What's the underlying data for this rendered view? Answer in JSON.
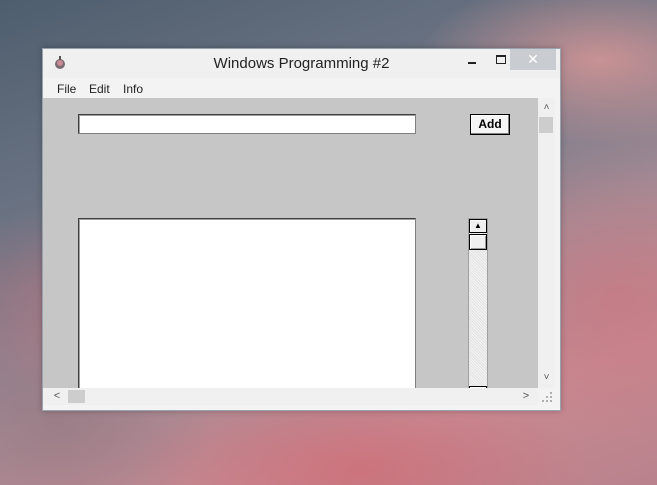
{
  "window": {
    "title": "Windows Programming #2",
    "controls": {
      "minimize_icon": "minimize-icon",
      "maximize_icon": "maximize-icon",
      "close_glyph": "✕"
    }
  },
  "menu": {
    "items": [
      "File",
      "Edit",
      "Info"
    ]
  },
  "form": {
    "input_value": "",
    "add_label": "Add"
  },
  "icons": {
    "app": "app-icon",
    "scroll_up": "▲",
    "scroll_down": "▼",
    "win_up": "˄",
    "win_down": "˅",
    "win_left": "<",
    "win_right": ">"
  },
  "colors": {
    "client_background": "#c6c6c6",
    "window_frame": "#f3f3f3",
    "close_button": "#c9ccd0"
  }
}
